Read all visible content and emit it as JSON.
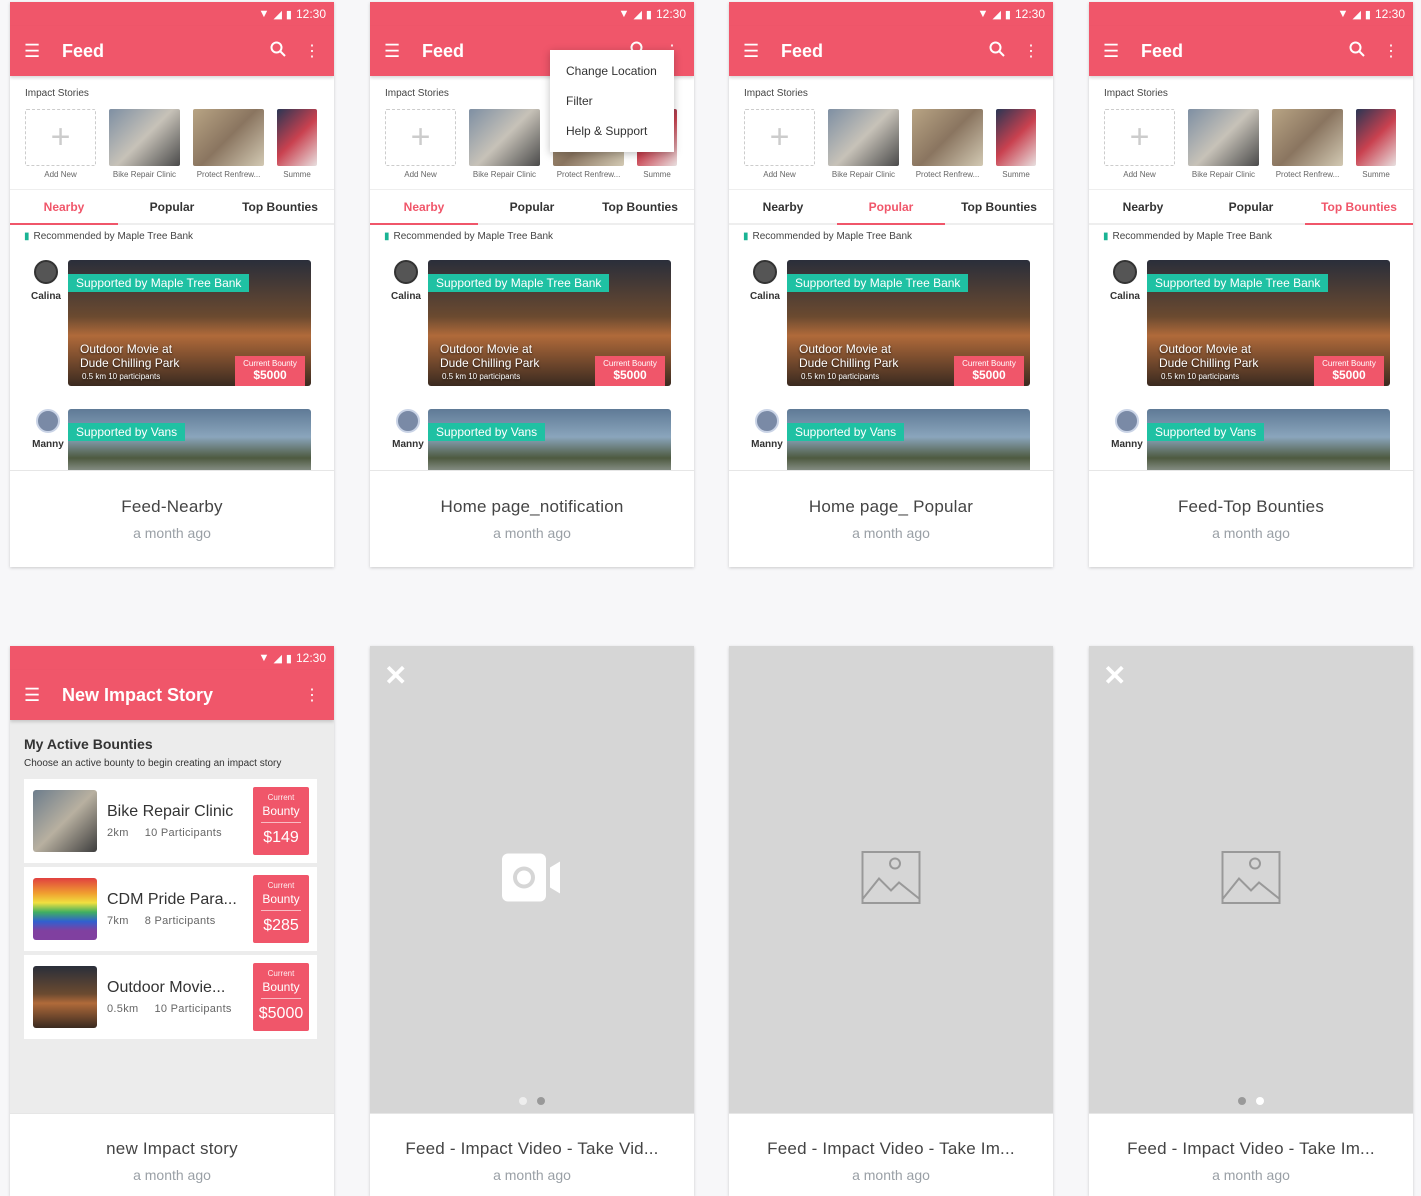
{
  "status": {
    "time": "12:30"
  },
  "feed": {
    "title": "Feed",
    "stories_label": "Impact Stories",
    "stories": [
      "Add New",
      "Bike Repair Clinic",
      "Protect Renfrew...",
      "Summe"
    ],
    "tabs": [
      "Nearby",
      "Popular",
      "Top Bounties"
    ],
    "recommended": "Recommended by Maple Tree Bank",
    "post1": {
      "user": "Calina",
      "sponsor": "Supported by Maple Tree Bank",
      "title_line1": "Outdoor Movie at",
      "title_line2": "Dude Chilling Park",
      "meta": "0.5 km   10 participants",
      "bounty_label": "Current Bounty",
      "bounty_value": "$5000"
    },
    "post2": {
      "user": "Manny",
      "sponsor": "Supported by Vans"
    }
  },
  "dropdown": {
    "items": [
      "Change Location",
      "Filter",
      "Help & Support"
    ]
  },
  "new_story": {
    "title": "New Impact Story",
    "heading": "My Active Bounties",
    "subtitle": "Choose an active bounty to begin creating an impact story",
    "items": [
      {
        "name": "Bike Repair Clinic",
        "distance": "2km",
        "participants": "10 Participants",
        "badge_top": "Current",
        "badge_mid": "Bounty",
        "amount": "$149"
      },
      {
        "name": "CDM Pride Para...",
        "distance": "7km",
        "participants": "8 Participants",
        "badge_top": "Current",
        "badge_mid": "Bounty",
        "amount": "$285"
      },
      {
        "name": "Outdoor Movie...",
        "distance": "0.5km",
        "participants": "10 Participants",
        "badge_top": "Current",
        "badge_mid": "Bounty",
        "amount": "$5000"
      }
    ]
  },
  "cards": [
    {
      "title": "Feed-Nearby",
      "time": "a month ago"
    },
    {
      "title": "Home page_notification",
      "time": "a month ago"
    },
    {
      "title": "Home page_ Popular",
      "time": "a month ago"
    },
    {
      "title": "Feed-Top Bounties",
      "time": "a month ago"
    },
    {
      "title": "new Impact story",
      "time": "a month ago"
    },
    {
      "title": "Feed - Impact Video - Take Vid...",
      "time": "a month ago"
    },
    {
      "title": "Feed - Impact Video - Take Im...",
      "time": "a month ago"
    },
    {
      "title": "Feed - Impact Video - Take Im...",
      "time": "a month ago"
    }
  ],
  "colors": {
    "accent": "#f0566a",
    "sponsor": "#1fc1a3",
    "placeholder": "#d6d6d6"
  },
  "icons": {
    "close": "close-icon",
    "video": "video-camera-icon",
    "image": "image-icon"
  }
}
